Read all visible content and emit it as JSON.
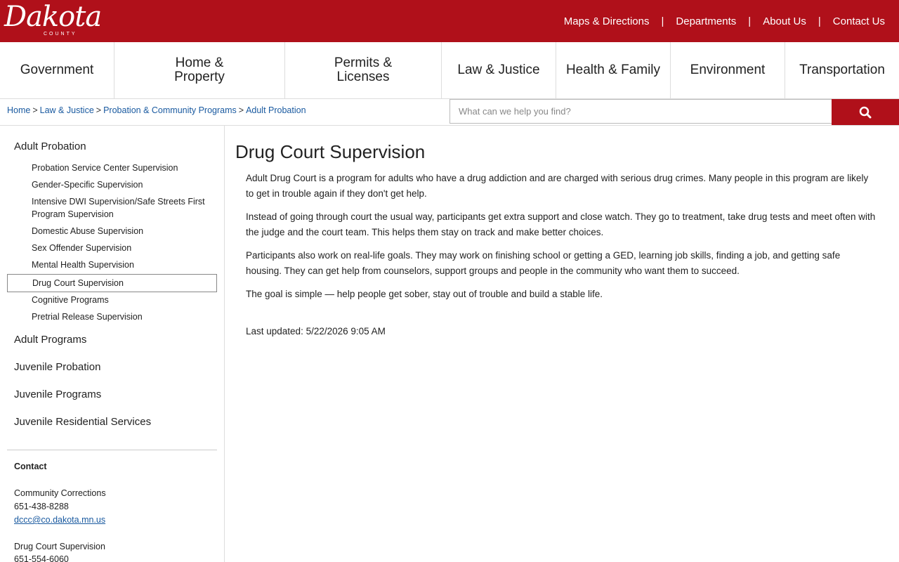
{
  "header": {
    "logo_text": "Dakota",
    "logo_sub": "COUNTY",
    "utility_links": [
      "Maps & Directions",
      "Departments",
      "About Us",
      "Contact Us"
    ],
    "separator": "|"
  },
  "main_nav": [
    "Government",
    "Home & Property",
    "Permits & Licenses",
    "Law & Justice",
    "Health & Family",
    "Environment",
    "Transportation"
  ],
  "breadcrumb": [
    "Home",
    "Law & Justice",
    "Probation & Community Programs",
    "Adult Probation"
  ],
  "breadcrumb_separator": ">",
  "search": {
    "placeholder": "What can we help you find?"
  },
  "sidebar": {
    "current_section": "Adult Probation",
    "sub_items": [
      "Probation Service Center Supervision",
      "Gender-Specific Supervision",
      "Intensive DWI Supervision/Safe Streets First Program Supervision",
      "Domestic Abuse Supervision",
      "Sex Offender Supervision",
      "Mental Health Supervision",
      "Drug Court Supervision",
      "Cognitive Programs",
      "Pretrial Release Supervision"
    ],
    "sections": [
      "Adult Programs",
      "Juvenile Probation",
      "Juvenile Programs",
      "Juvenile Residential Services"
    ],
    "contact": {
      "heading": "Contact",
      "entries": [
        {
          "name": "Community Corrections",
          "phone": "651-438-8288",
          "email": "dccc@co.dakota.mn.us"
        },
        {
          "name": "Drug Court Supervision",
          "phone": "651-554-6060"
        }
      ]
    }
  },
  "content": {
    "title": "Drug Court Supervision",
    "paragraphs": [
      "Adult Drug Court is a program for adults who have a drug addiction and are charged with serious drug crimes. Many people in this program are likely to get in trouble again if they don't get help.",
      "Instead of going through court the usual way, participants get extra support and close watch. They go to treatment, take drug tests and meet often with the judge and the court team. This helps them stay on track and make better choices.",
      "Participants also work on real-life goals. They may work on finishing school or getting a GED, learning job skills, finding a job, and getting safe housing. They can get help from counselors, support groups and people in the community who want them to succeed.",
      "The goal is simple — help people get sober, stay out of trouble and build a stable life."
    ],
    "last_updated": "Last updated: 5/22/2026 9:05 AM"
  },
  "colors": {
    "brand_red": "#b0101a",
    "link_blue": "#1a5aa0"
  }
}
